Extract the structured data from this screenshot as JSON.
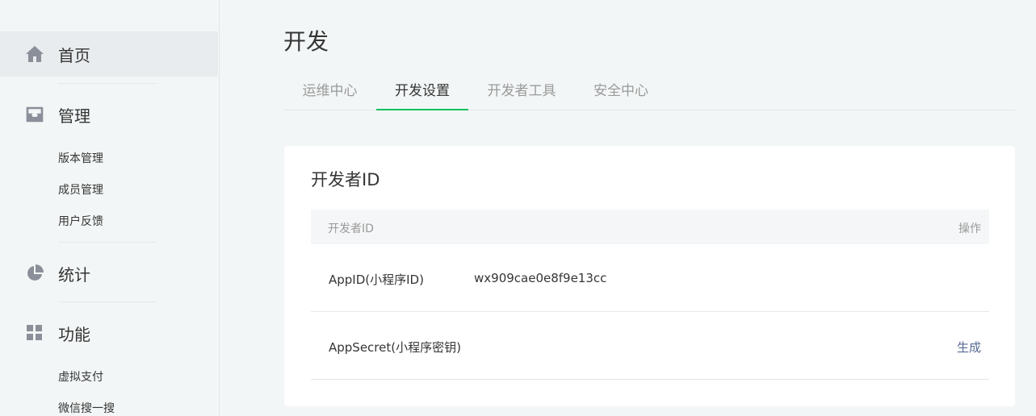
{
  "sidebar": {
    "home": {
      "label": "首页",
      "icon": "home-icon"
    },
    "manage": {
      "label": "管理",
      "icon": "inbox-icon",
      "items": [
        "版本管理",
        "成员管理",
        "用户反馈"
      ]
    },
    "stats": {
      "label": "统计",
      "icon": "pie-chart-icon"
    },
    "features": {
      "label": "功能",
      "icon": "grid-icon",
      "items": [
        "虚拟支付",
        "微信搜一搜"
      ]
    }
  },
  "page": {
    "title": "开发"
  },
  "tabs": [
    {
      "label": "运维中心",
      "active": false
    },
    {
      "label": "开发设置",
      "active": true
    },
    {
      "label": "开发者工具",
      "active": false
    },
    {
      "label": "安全中心",
      "active": false
    }
  ],
  "developer_id": {
    "title": "开发者ID",
    "columns": {
      "name": "开发者ID",
      "action": "操作"
    },
    "rows": [
      {
        "name": "AppID(小程序ID)",
        "value": "wx909cae0e8f9e13cc",
        "action": ""
      },
      {
        "name": "AppSecret(小程序密钥)",
        "value": "",
        "action": "生成"
      }
    ]
  },
  "colors": {
    "accent": "#07c160",
    "link": "#576b95",
    "icon": "#8a8f99"
  }
}
